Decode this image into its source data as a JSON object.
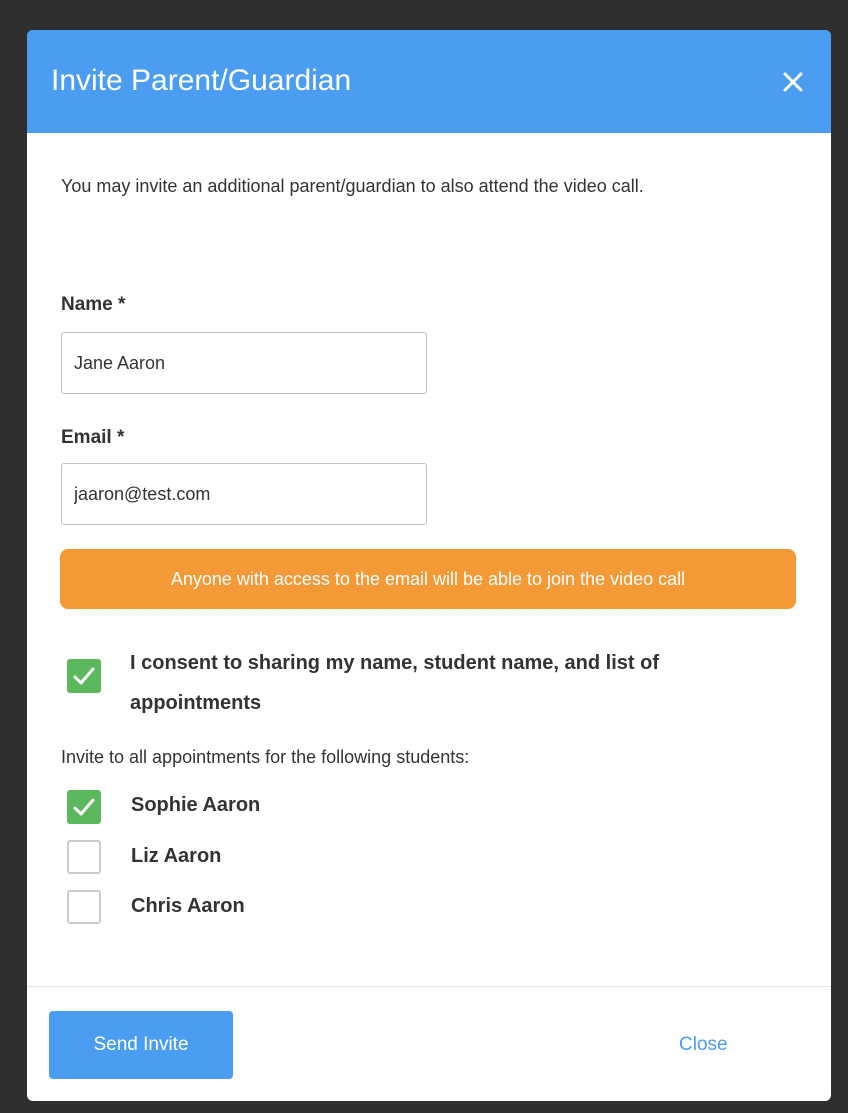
{
  "modal": {
    "title": "Invite Parent/Guardian",
    "close_icon": "close-icon"
  },
  "intro": {
    "text": "You may invite an additional parent/guardian to also attend the video call."
  },
  "form": {
    "name_label": "Name *",
    "name_value": "Jane Aaron",
    "email_label": "Email *",
    "email_value": "jaaron@test.com"
  },
  "warning": {
    "text": "Anyone with access to the email will be able to join the video call",
    "color": "#f39a37"
  },
  "consent": {
    "checked": true,
    "label": "I consent to sharing my name, student name, and list of appointments"
  },
  "students": {
    "heading": "Invite to all appointments for the following students:",
    "items": [
      {
        "name": "Sophie Aaron",
        "checked": true
      },
      {
        "name": "Liz Aaron",
        "checked": false
      },
      {
        "name": "Chris Aaron",
        "checked": false
      }
    ]
  },
  "footer": {
    "send_label": "Send Invite",
    "close_label": "Close"
  },
  "colors": {
    "accent": "#4a9df0",
    "check_green": "#5cb85c"
  }
}
